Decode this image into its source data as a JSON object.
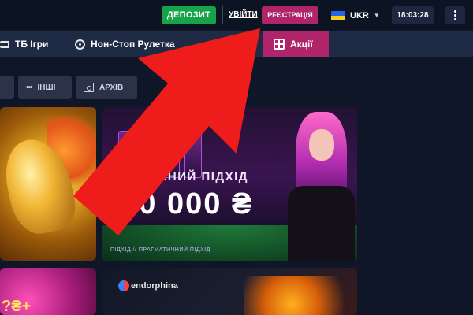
{
  "header": {
    "deposit_label": "ДЕПОЗИТ",
    "login_label": "УВІЙТИ",
    "register_label": "РЕЄСТРАЦІЯ",
    "language": "UKR",
    "time": "18:03:28"
  },
  "nav": {
    "tv_games": "ТБ Ігри",
    "nonstop_roulette": "Нон-Стоп Рулетка",
    "promotions": "Акції"
  },
  "filters": {
    "other": "ІНШІ",
    "archive": "АРХІВ"
  },
  "promo_cards": {
    "pragmatic_heading": "АГМАТИЧНИЙ ПІДХІД",
    "pragmatic_amount": "500 000 ₴",
    "pragmatic_footer": "ПІДХІД // ПРАГМАТИЧНИЙ ПІДХІД",
    "endorphina_brand": "endorphina",
    "pink_partial_text": "?₴+"
  },
  "colors": {
    "deposit": "#16a34a",
    "register": "#b0246a",
    "arrow": "#ef1c1c",
    "background": "#0f1628"
  },
  "icons": {
    "tv": "tv-icon",
    "roulette": "roulette-icon",
    "promotions": "gift-icon",
    "other": "dots-icon",
    "archive": "archive-icon",
    "menu": "kebab-menu-icon",
    "language_flag": "ukraine-flag-icon",
    "language_dropdown": "chevron-down-icon"
  }
}
